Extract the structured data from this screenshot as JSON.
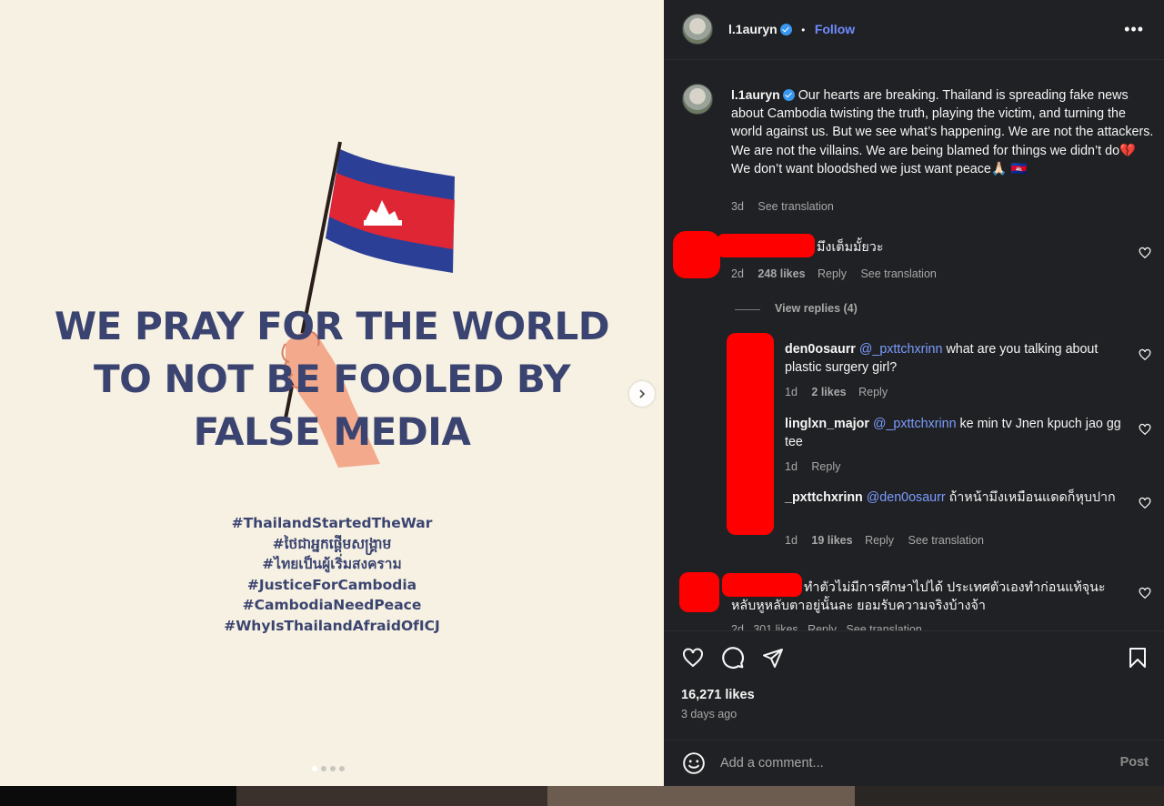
{
  "post_image": {
    "headline": "WE PRAY FOR THE WORLD TO NOT BE FOOLED BY FALSE MEDIA",
    "hashtags": [
      "#ThailandStartedTheWar",
      "#ថៃជាអ្នកផ្តើមសង្គ្រាម",
      "#ไทยเป็นผู้เริ่มสงคราม",
      "#JusticeForCambodia",
      "#CambodiaNeedPeace",
      "#WhyIsThailandAfraidOfICJ"
    ],
    "carousel": {
      "total": 4,
      "current": 1
    }
  },
  "header": {
    "username": "l.1auryn",
    "separator": "•",
    "follow_label": "Follow",
    "more_label": "•••"
  },
  "caption": {
    "username": "l.1auryn",
    "text": "Our hearts are breaking. Thailand is spreading fake news about Cambodia twisting the truth, playing the victim, and turning the world against us. But we see what’s happening. We are not the attackers. We are not the villains. We are being blamed for things we didn’t do💔 We don’t want bloodshed we just want peace🙏🏻 🇰🇭",
    "time": "3d",
    "see_translation": "See translation"
  },
  "comments": [
    {
      "text": "มึงเต็มมั้ยวะ",
      "time": "2d",
      "likes": "248 likes",
      "reply": "Reply",
      "see_translation": "See translation",
      "view_replies": "View replies (4)"
    }
  ],
  "replies": [
    {
      "username": "den0osaurr",
      "mention": "@_pxttchxrinn",
      "text": " what are you talking about plastic surgery girl?",
      "time": "1d",
      "likes": "2 likes",
      "reply": "Reply"
    },
    {
      "username": "linglxn_major",
      "mention": "@_pxttchxrinn",
      "text": " ke min tv Jnen kpuch jao gg tee",
      "time": "1d",
      "reply": "Reply"
    },
    {
      "username": "_pxttchxrinn",
      "mention": "@den0osaurr",
      "text": " ถ้าหน้ามึงเหมือนแดดก็หุบปาก",
      "time": "1d",
      "likes": "19 likes",
      "reply": "Reply",
      "see_translation": "See translation"
    }
  ],
  "comment2": {
    "text": "ทำตัวไม่มีการศึกษาไปได้ ประเทศตัวเองทำก่อนแท้จุนะ หลับหูหลับตาอยู่นั้นละ ยอมรับความจริงบ้างจ้า",
    "meta_partial": "2d   301 likes   Reply   See translation"
  },
  "footer": {
    "likes": "16,271 likes",
    "posted": "3 days ago",
    "comment_placeholder": "Add a comment...",
    "post_label": "Post"
  },
  "colors": {
    "panel_bg": "#202124",
    "image_bg": "#f6f1e2",
    "headline": "#3b4470",
    "accent_link": "#6f8cff",
    "redaction": "#ff0000"
  }
}
